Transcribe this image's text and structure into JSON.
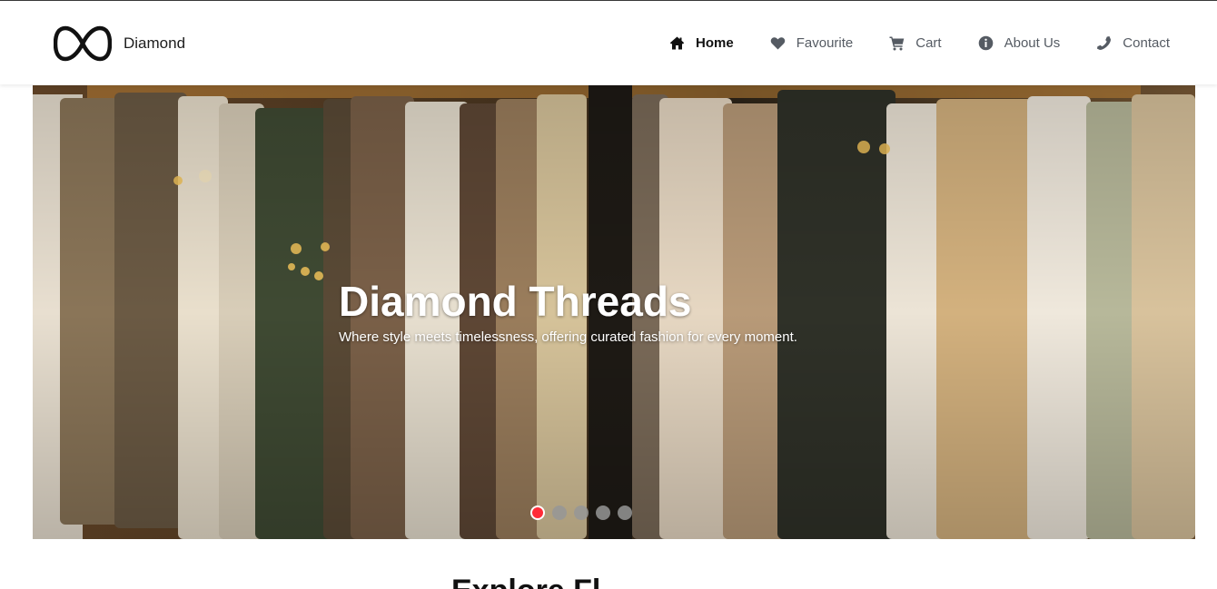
{
  "brand": {
    "name": "Diamond",
    "logo_icon": "infinity-logo-icon"
  },
  "nav": {
    "items": [
      {
        "label": "Home",
        "icon": "home-icon",
        "active": true
      },
      {
        "label": "Favourite",
        "icon": "heart-icon",
        "active": false
      },
      {
        "label": "Cart",
        "icon": "cart-icon",
        "active": false
      },
      {
        "label": "About Us",
        "icon": "info-icon",
        "active": false
      },
      {
        "label": "Contact",
        "icon": "phone-icon",
        "active": false
      }
    ]
  },
  "hero": {
    "title": "Diamond Threads",
    "subtitle": "Where style meets timelessness, offering curated fashion for every moment.",
    "slide_count": 5,
    "active_slide": 1,
    "indicator_active_color": "#ff2b37"
  },
  "section": {
    "heading": "Explore Fl"
  },
  "colors": {
    "nav_text": "#555b63",
    "nav_active": "#111111",
    "accent": "#ff2b37"
  }
}
